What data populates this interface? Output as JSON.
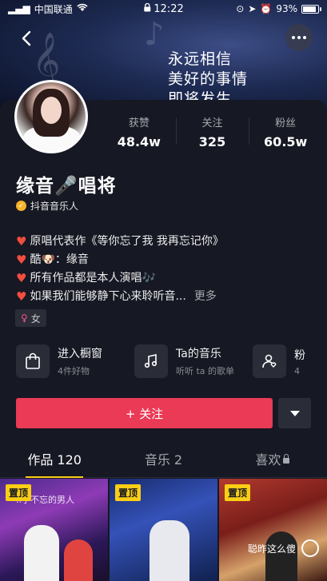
{
  "status_bar": {
    "carrier": "中国联通",
    "time": "12:22",
    "battery": "93%",
    "battery_level": 0.93
  },
  "banner": {
    "lyric_lines": [
      "永远相信",
      "美好的事情",
      "即将发生"
    ]
  },
  "profile": {
    "name": "缘音🎤唱将",
    "verification": "抖音音乐人",
    "stats": [
      {
        "label": "获赞",
        "value": "48.4w"
      },
      {
        "label": "关注",
        "value": "325"
      },
      {
        "label": "粉丝",
        "value": "60.5w"
      }
    ],
    "bio": [
      "原唱代表作《等你忘了我 我再忘记你》",
      "酷🐶：缘音",
      "所有作品都是本人演唱🎶",
      "如果我们能够静下心来聆听音..."
    ],
    "bio_more": "更多",
    "gender": "女"
  },
  "entries": [
    {
      "title": "进入橱窗",
      "subtitle": "4件好物",
      "icon": "shopping-bag-icon"
    },
    {
      "title": "Ta的音乐",
      "subtitle": "听听 ta 的歌单",
      "icon": "music-note-icon"
    },
    {
      "title": "粉",
      "subtitle": "4",
      "icon": "fans-group-icon"
    }
  ],
  "actions": {
    "follow_label": "+ 关注"
  },
  "tabs": [
    {
      "label": "作品 120",
      "active": true
    },
    {
      "label": "音乐 2",
      "active": false
    },
    {
      "label": "喜欢",
      "active": false,
      "locked": true
    }
  ],
  "videos": [
    {
      "badge": "置顶",
      "caption": "..手不忘的男人"
    },
    {
      "badge": "置顶",
      "caption": ""
    },
    {
      "badge": "置顶",
      "caption": "聪昨这么傻"
    }
  ],
  "colors": {
    "background": "#161823",
    "follow_button": "#ea3a56",
    "tab_indicator": "#face15",
    "heart": "#f24d3f"
  }
}
